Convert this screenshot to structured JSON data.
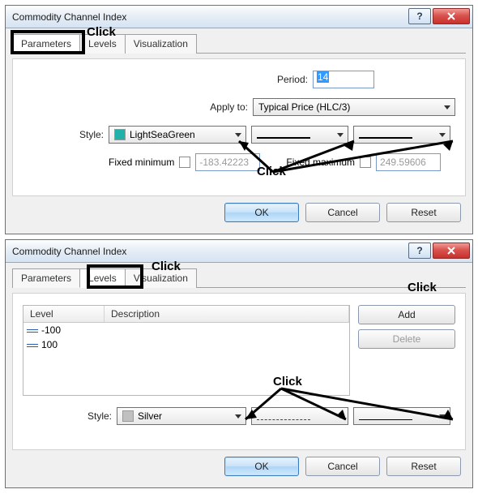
{
  "dialog1": {
    "title": "Commodity Channel Index",
    "tabs": [
      "Parameters",
      "Levels",
      "Visualization"
    ],
    "activeTab": 0,
    "periodLabel": "Period:",
    "periodValue": "14",
    "applyLabel": "Apply to:",
    "applyValue": "Typical Price (HLC/3)",
    "styleLabel": "Style:",
    "styleColorName": "LightSeaGreen",
    "styleColorHex": "#20B2AA",
    "fixedMinLabel": "Fixed minimum",
    "fixedMinValue": "-183.42223",
    "fixedMaxLabel": "Fixed maximum",
    "fixedMaxValue": "249.59606",
    "ok": "OK",
    "cancel": "Cancel",
    "reset": "Reset",
    "annoTab": "Click",
    "annoStyle": "Click"
  },
  "dialog2": {
    "title": "Commodity Channel Index",
    "tabs": [
      "Parameters",
      "Levels",
      "Visualization"
    ],
    "activeTab": 1,
    "levelHeader": "Level",
    "descHeader": "Description",
    "levels": [
      "-100",
      "100"
    ],
    "addLabel": "Add",
    "deleteLabel": "Delete",
    "styleLabel": "Style:",
    "styleColorName": "Silver",
    "styleColorHex": "#C0C0C0",
    "ok": "OK",
    "cancel": "Cancel",
    "reset": "Reset",
    "annoTab": "Click",
    "annoAdd": "Click",
    "annoStyle": "Click"
  }
}
